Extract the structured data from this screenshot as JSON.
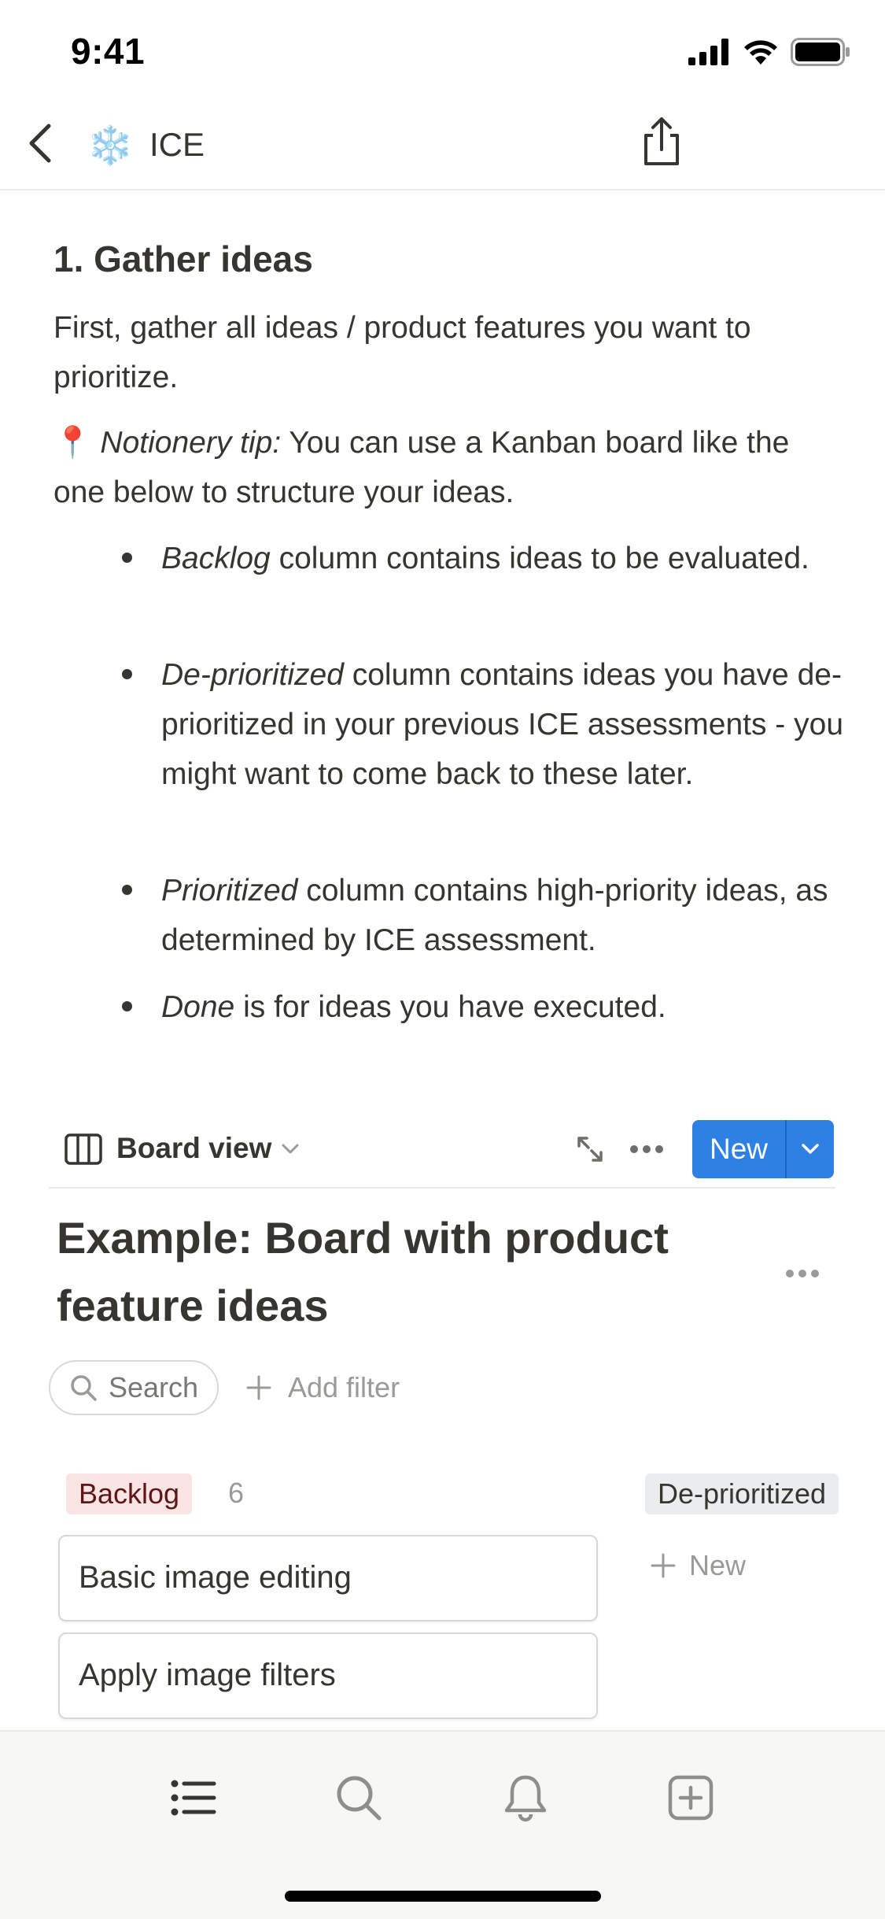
{
  "status_bar": {
    "time": "9:41"
  },
  "nav": {
    "emoji": "❄️",
    "title": "ICE"
  },
  "section": {
    "heading": "1. Gather ideas",
    "intro": "First, gather all ideas / product features you want to prioritize.",
    "tip_emoji": "📍",
    "tip_label": "Notionery tip:",
    "tip_text": " You can use a Kanban board like the one below to structure your ideas.",
    "bullets": [
      {
        "em": "Backlog",
        "text": " column contains ideas to be evaluated."
      },
      {
        "em": "De-prioritized",
        "text": " column contains ideas you have de-prioritized in your previous ICE assessments - you might want to come back to these later."
      },
      {
        "em": "Prioritized",
        "text": " column contains high-priority ideas, as determined by ICE assessment."
      },
      {
        "em": "Done",
        "text": " is for ideas you have executed."
      }
    ]
  },
  "board": {
    "view_label": "Board view",
    "new_label": "New",
    "title": "Example: Board with product feature ideas",
    "search_label": "Search",
    "add_filter_label": "Add filter",
    "columns": [
      {
        "label": "Backlog",
        "count": "6",
        "cards": [
          "Basic image editing",
          "Apply image filters"
        ]
      },
      {
        "label": "De-prioritized",
        "new_label": "New"
      }
    ]
  },
  "tabbar": {
    "icons": [
      "list-icon",
      "search-icon",
      "bell-icon",
      "plus-square-icon"
    ]
  },
  "colors": {
    "accent": "#2f80e3",
    "backlog_tag_bg": "#fbe4e4",
    "deprio_tag_bg": "#ebeced",
    "text": "#37352f"
  }
}
